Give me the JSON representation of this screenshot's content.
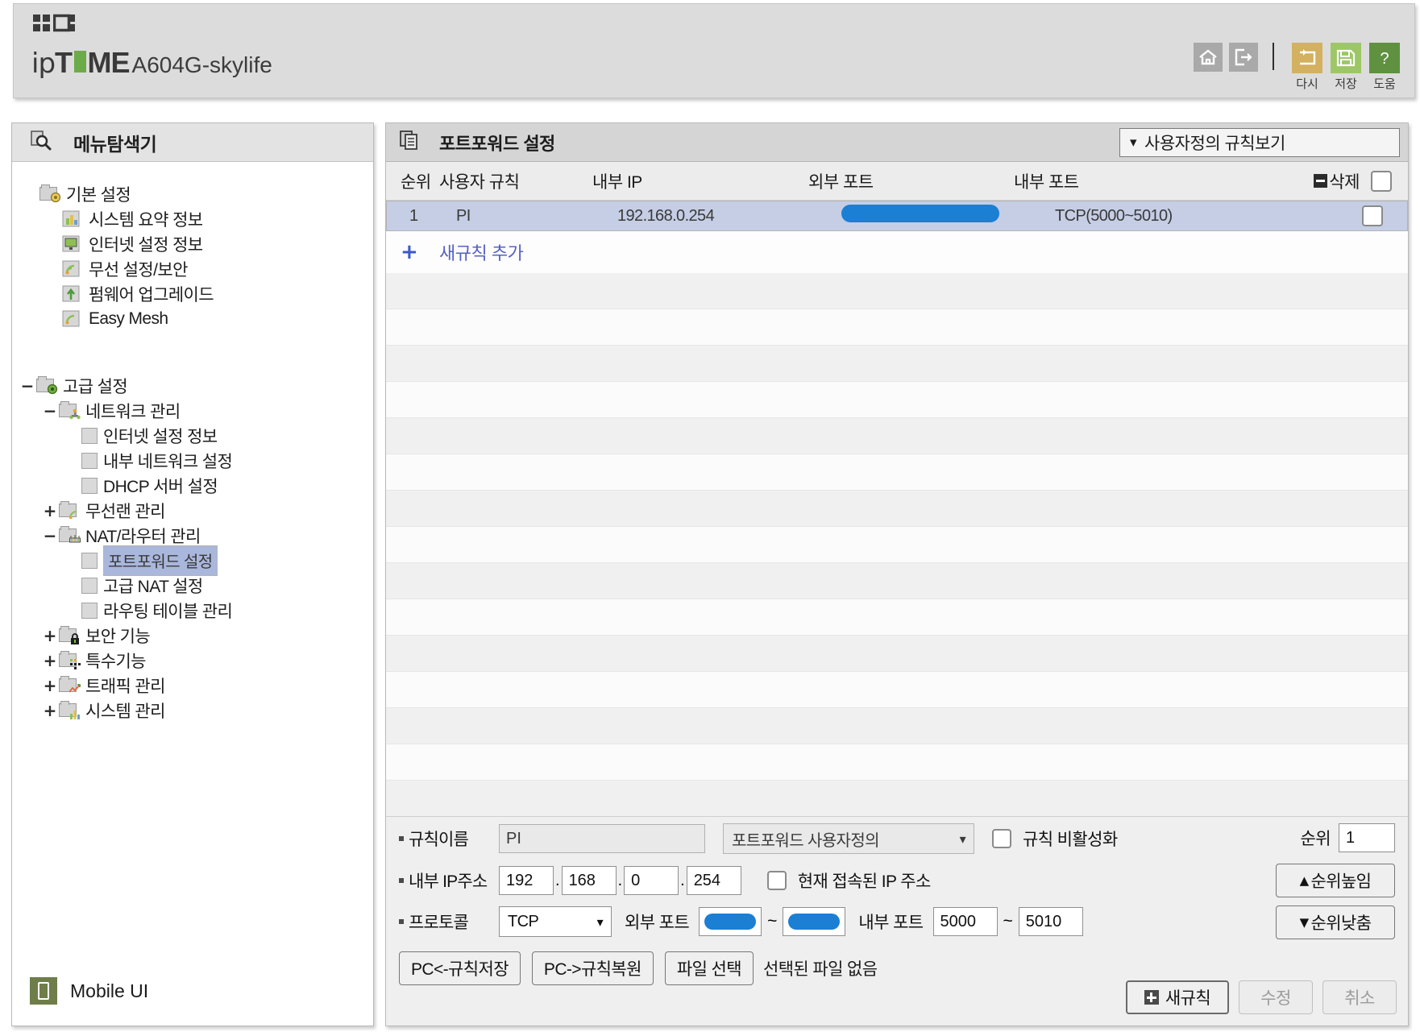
{
  "header": {
    "logo_ip": "ip",
    "logo_t": "T",
    "logo_me": "ME",
    "model": "A604G-skylife",
    "icons": {
      "home": "home-icon",
      "logout": "logout-icon",
      "retry_label": "다시",
      "save_label": "저장",
      "help_label": "도움"
    },
    "colors": {
      "retry": "#d3b160",
      "save": "#9dc766",
      "help": "#5f9140",
      "gray": "#a9a9a9"
    }
  },
  "sidebar": {
    "title": "메뉴탐색기",
    "search_icon": "menu-search-icon",
    "mobile_ui_label": "Mobile UI",
    "groups": [
      {
        "expander": "",
        "label": "기본 설정",
        "icon": "folder-gear-icon",
        "indent": 0,
        "children": [
          {
            "label": "시스템 요약 정보",
            "icon": "chart-icon",
            "indent": 1
          },
          {
            "label": "인터넷 설정 정보",
            "icon": "monitor-icon",
            "indent": 1
          },
          {
            "label": "무선 설정/보안",
            "icon": "wifi-icon",
            "indent": 1
          },
          {
            "label": "펌웨어 업그레이드",
            "icon": "upload-icon",
            "indent": 1
          },
          {
            "label": "Easy Mesh",
            "icon": "mesh-icon",
            "indent": 1
          }
        ]
      }
    ],
    "items": [
      {
        "expander": "−",
        "label": "고급 설정",
        "icon": "folder-gear-icon",
        "indent": 0,
        "selected": false
      },
      {
        "expander": "−",
        "label": "네트워크 관리",
        "icon": "folder-network-icon",
        "indent": 1,
        "selected": false
      },
      {
        "expander": "",
        "label": "인터넷 설정 정보",
        "icon": "leaf-icon",
        "indent": 2,
        "selected": false
      },
      {
        "expander": "",
        "label": "내부 네트워크 설정",
        "icon": "leaf-icon",
        "indent": 2,
        "selected": false
      },
      {
        "expander": "",
        "label": "DHCP 서버 설정",
        "icon": "leaf-icon",
        "indent": 2,
        "selected": false
      },
      {
        "expander": "+",
        "label": "무선랜 관리",
        "icon": "folder-wifi-icon",
        "indent": 1,
        "selected": false
      },
      {
        "expander": "−",
        "label": "NAT/라우터 관리",
        "icon": "folder-router-icon",
        "indent": 1,
        "selected": false
      },
      {
        "expander": "",
        "label": "포트포워드 설정",
        "icon": "leaf-icon",
        "indent": 2,
        "selected": true
      },
      {
        "expander": "",
        "label": "고급 NAT 설정",
        "icon": "leaf-icon",
        "indent": 2,
        "selected": false
      },
      {
        "expander": "",
        "label": "라우팅 테이블 관리",
        "icon": "leaf-icon",
        "indent": 2,
        "selected": false
      },
      {
        "expander": "+",
        "label": "보안 기능",
        "icon": "folder-lock-icon",
        "indent": 1,
        "selected": false
      },
      {
        "expander": "+",
        "label": "특수기능",
        "icon": "folder-dots-icon",
        "indent": 1,
        "selected": false
      },
      {
        "expander": "+",
        "label": "트래픽 관리",
        "icon": "folder-traffic-icon",
        "indent": 1,
        "selected": false
      },
      {
        "expander": "+",
        "label": "시스템 관리",
        "icon": "folder-chart-icon",
        "indent": 1,
        "selected": false
      }
    ]
  },
  "panel": {
    "title": "포트포워드 설정",
    "title_icon": "portforward-icon",
    "view_selector": "사용자정의 규칙보기",
    "table": {
      "headers": {
        "rank": "순위",
        "rule": "사용자 규칙",
        "internal_ip": "내부 IP",
        "external_port": "외부 포트",
        "internal_port": "내부 포트",
        "delete": "삭제"
      },
      "rows": [
        {
          "rank": "1",
          "rule": "PI",
          "internal_ip": "192.168.0.254",
          "external_port": "",
          "external_port_redacted": true,
          "internal_port": "TCP(5000~5010)",
          "selected": true
        }
      ],
      "add_rule_label": "새규칙 추가",
      "add_rule_icon": "plus-icon"
    },
    "form": {
      "rule_name_label": "규칙이름",
      "rule_name_value": "PI",
      "preset_select": "포트포워드 사용자정의",
      "disable_rule_label": "규칙 비활성화",
      "internal_ip_label": "내부 IP주소",
      "internal_ip": [
        "192",
        "168",
        "0",
        "254"
      ],
      "current_ip_label": "현재 접속된 IP 주소",
      "protocol_label": "프로토콜",
      "protocol_value": "TCP",
      "external_port_label": "외부 포트",
      "external_port_from": "",
      "external_port_to": "",
      "external_port_redacted": true,
      "internal_port_label": "내부 포트",
      "internal_port_from": "5000",
      "internal_port_to": "5010",
      "range_sep": "~",
      "rank_label": "순위",
      "rank_value": "1",
      "rank_up": "순위높임",
      "rank_down": "순위낮춤",
      "save_to_pc": "PC<-규칙저장",
      "restore_from_pc": "PC->규칙복원",
      "choose_file": "파일 선택",
      "no_file": "선택된 파일 없음",
      "new_rule": "새규칙",
      "modify": "수정",
      "cancel": "취소"
    }
  },
  "colors": {
    "redaction": "#1b7fd4",
    "selected_row": "#c5cee4",
    "link": "#5561c7",
    "tree_select": "#aab7dc"
  }
}
